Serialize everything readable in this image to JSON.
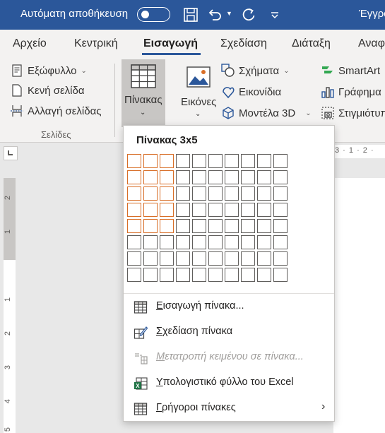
{
  "titlebar": {
    "autosave_label": "Αυτόματη αποθήκευση",
    "doc_title": "Έγγρα"
  },
  "tabs": [
    {
      "label": "Αρχείο"
    },
    {
      "label": "Κεντρική"
    },
    {
      "label": "Εισαγωγή"
    },
    {
      "label": "Σχεδίαση"
    },
    {
      "label": "Διάταξη"
    },
    {
      "label": "Αναφ"
    }
  ],
  "ribbon": {
    "pages": {
      "cover": "Εξώφυλλο",
      "blank": "Κενή σελίδα",
      "page_break": "Αλλαγή σελίδας",
      "group_label": "Σελίδες"
    },
    "table_label": "Πίνακας",
    "pictures_label": "Εικόνες",
    "shapes": "Σχήματα",
    "icons": "Εικονίδια",
    "models3d": "Μοντέλα 3D",
    "smartart": "SmartArt",
    "chart": "Γράφημα",
    "screenshot": "Στιγμιότυπο"
  },
  "ruler": {
    "h_text": "3 · 1 · 2 ·",
    "v_numbers": [
      "2",
      "1",
      "1",
      "2",
      "3",
      "4",
      "5"
    ]
  },
  "dropdown": {
    "title": "Πίνακας 3x5",
    "grid": {
      "columns": 10,
      "rows": 8,
      "selected_columns": 3,
      "selected_rows": 5
    },
    "items": [
      {
        "label": "Εισαγωγή πίνακα...",
        "underline": "Ε",
        "rest": "ισαγωγή πίνακα...",
        "icon": "insert-table-icon",
        "enabled": true
      },
      {
        "label": "Σχεδίαση πίνακα",
        "underline": "Σ",
        "rest": "χεδίαση πίνακα",
        "icon": "draw-table-icon",
        "enabled": true
      },
      {
        "label": "Μετατροπή κειμένου σε πίνακα...",
        "underline": "Μ",
        "rest": "ετατροπή κειμένου σε πίνακα...",
        "icon": "convert-text-icon",
        "enabled": false
      },
      {
        "label": "Υπολογιστικό φύλλο του Excel",
        "underline": "Υ",
        "rest": "πολογιστικό φύλλο του Excel",
        "icon": "excel-icon",
        "enabled": true
      },
      {
        "label": "Γρήγοροι πίνακες",
        "underline": "Γ",
        "rest": "ρήγοροι πίνακες",
        "icon": "quick-tables-icon",
        "enabled": true
      }
    ]
  },
  "colors": {
    "titlebar": "#2b579a",
    "grid_selected": "#d86e27",
    "disabled_text": "#a19f9d"
  }
}
